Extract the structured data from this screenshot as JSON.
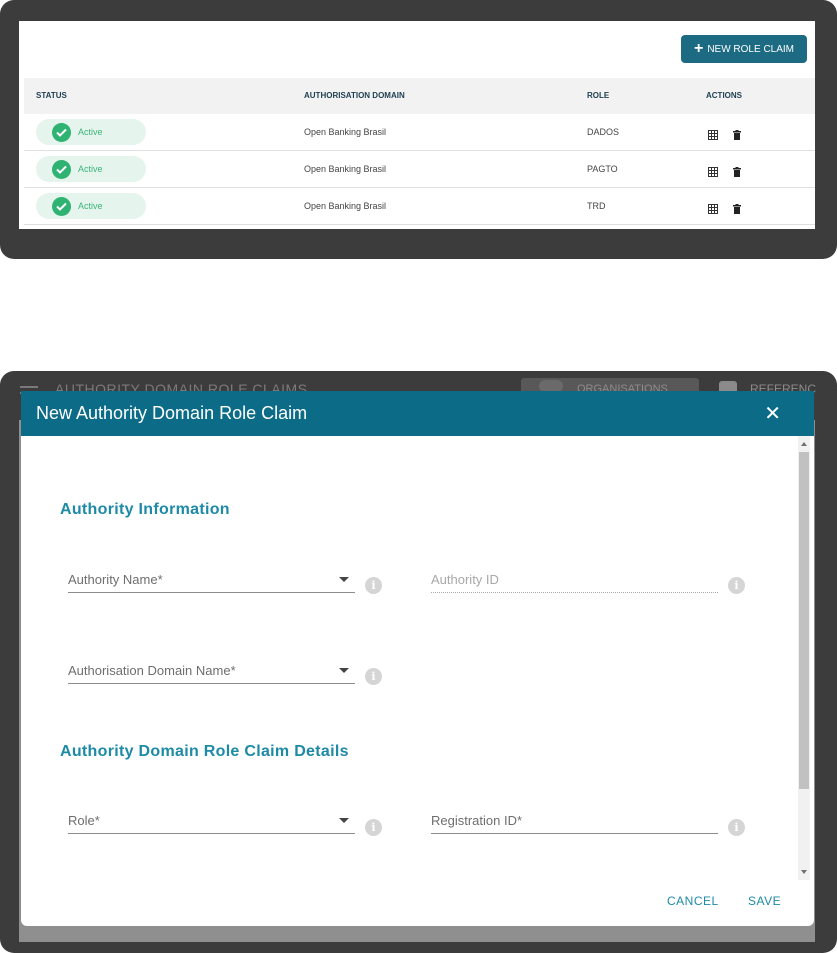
{
  "top": {
    "new_button_label": "NEW ROLE CLAIM",
    "columns": [
      "STATUS",
      "AUTHORISATION DOMAIN",
      "ROLE",
      "ACTIONS"
    ],
    "rows": [
      {
        "status": "Active",
        "domain": "Open Banking Brasil",
        "role": "DADOS"
      },
      {
        "status": "Active",
        "domain": "Open Banking Brasil",
        "role": "PAGTO"
      },
      {
        "status": "Active",
        "domain": "Open Banking Brasil",
        "role": "TRD"
      }
    ]
  },
  "background": {
    "page_title": "AUTHORITY DOMAIN ROLE CLAIMS",
    "tab_label": "ORGANISATIONS",
    "ref_label": "REFERENC"
  },
  "dialog": {
    "title": "New Authority Domain Role Claim",
    "close_glyph": "✕",
    "section1": "Authority Information",
    "section2": "Authority Domain Role Claim Details",
    "fields": {
      "authority_name": "Authority Name*",
      "authority_id": "Authority ID",
      "authorisation_domain_name": "Authorisation Domain Name*",
      "role": "Role*",
      "registration_id": "Registration ID*"
    },
    "info_glyph": "i",
    "cancel_label": "CANCEL",
    "save_label": "SAVE"
  },
  "colors": {
    "accent": "#0c6b87",
    "button": "#1c6b82",
    "active_green": "#2fb372",
    "section_text": "#1d8aa6"
  }
}
